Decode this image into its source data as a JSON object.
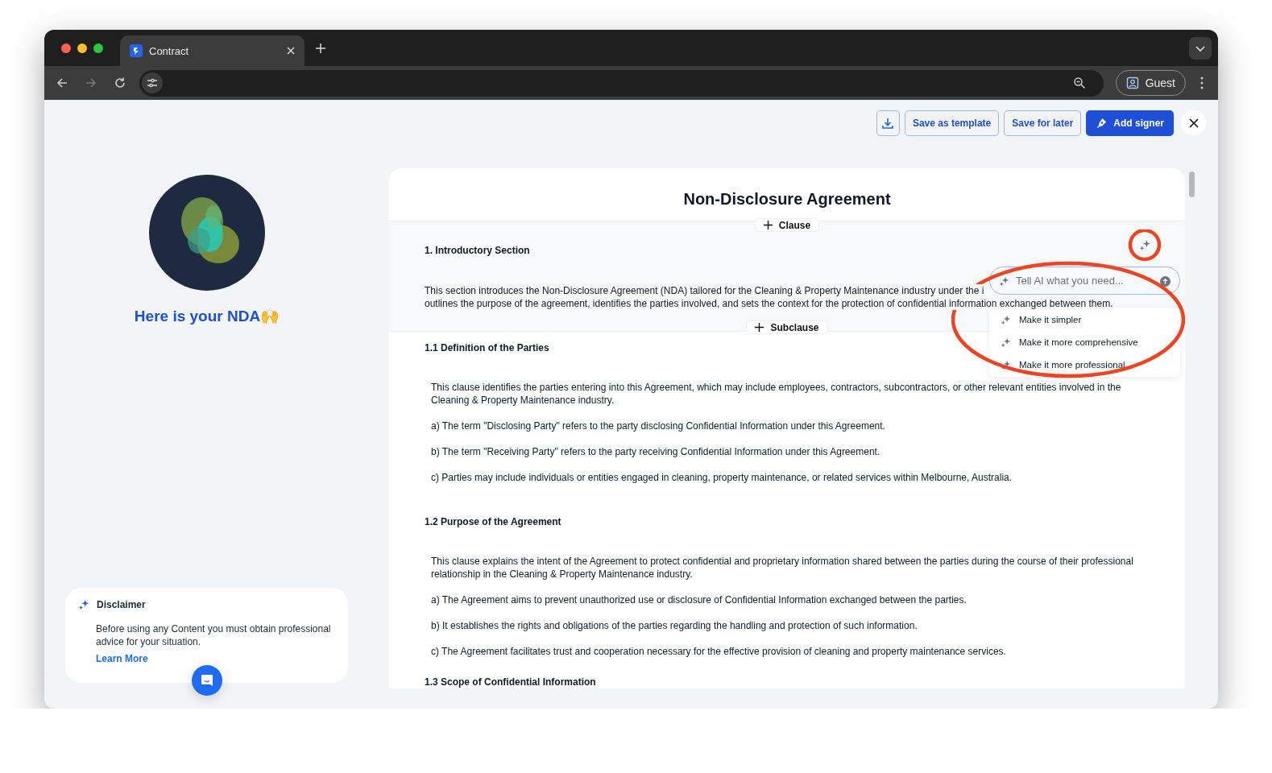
{
  "browser": {
    "tab_title": "Contract",
    "profile": "Guest"
  },
  "actions": {
    "save_template": "Save as template",
    "save_later": "Save for later",
    "add_signer": "Add signer"
  },
  "sidebar": {
    "heading": "Here is your NDA🙌",
    "disclaimer": {
      "title": "Disclaimer",
      "body": "Before using any Content you must obtain professional advice for your situation.",
      "link": "Learn More"
    }
  },
  "document": {
    "title": "Non-Disclosure Agreement",
    "add_clause": "Clause",
    "sections": [
      {
        "heading": "1. Introductory Section",
        "selected": true,
        "add_subclause": "Subclause",
        "paragraphs": [
          {
            "lines": [
              "This section introduces the Non-Disclosure Agreement (NDA) tailored for the Cleaning & Property Maintenance industry under the i",
              "outlines the purpose of the agreement, identifies the parties involved, and sets the context for the protection of confidential information exchanged between them."
            ]
          }
        ]
      },
      {
        "heading": "1.1 Definition of the Parties",
        "selected": false,
        "paragraphs": [
          {
            "lines": [
              "This clause identifies the parties entering into this Agreement, which may include employees, contractors, subcontractors, or other relevant entities involved in the",
              "Cleaning & Property Maintenance industry."
            ]
          },
          {
            "lines": [
              "a) The term \"Disclosing Party\" refers to the party disclosing Confidential Information under this Agreement."
            ]
          },
          {
            "lines": [
              "b) The term \"Receiving Party\" refers to the party receiving Confidential Information under this Agreement."
            ]
          },
          {
            "lines": [
              "c) Parties may include individuals or entities engaged in cleaning, property maintenance, or related services within Melbourne, Australia."
            ]
          }
        ]
      },
      {
        "heading": "1.2 Purpose of the Agreement",
        "selected": false,
        "paragraphs": [
          {
            "lines": [
              "This clause explains the intent of the Agreement to protect confidential and proprietary information shared between the parties during the course of their professional",
              "relationship in the Cleaning & Property Maintenance industry."
            ]
          },
          {
            "lines": [
              "a) The Agreement aims to prevent unauthorized use or disclosure of Confidential Information exchanged between the parties."
            ]
          },
          {
            "lines": [
              "b) It establishes the rights and obligations of the parties regarding the handling and protection of such information."
            ]
          },
          {
            "lines": [
              "c) The Agreement facilitates trust and cooperation necessary for the effective provision of cleaning and property maintenance services."
            ]
          }
        ]
      },
      {
        "heading": "1.3 Scope of Confidential Information",
        "selected": false
      }
    ]
  },
  "ai_popup": {
    "placeholder": "Tell AI what you need...",
    "suggestions": [
      "Make it simpler",
      "Make it more comprehensive",
      "Make it more professional"
    ]
  }
}
